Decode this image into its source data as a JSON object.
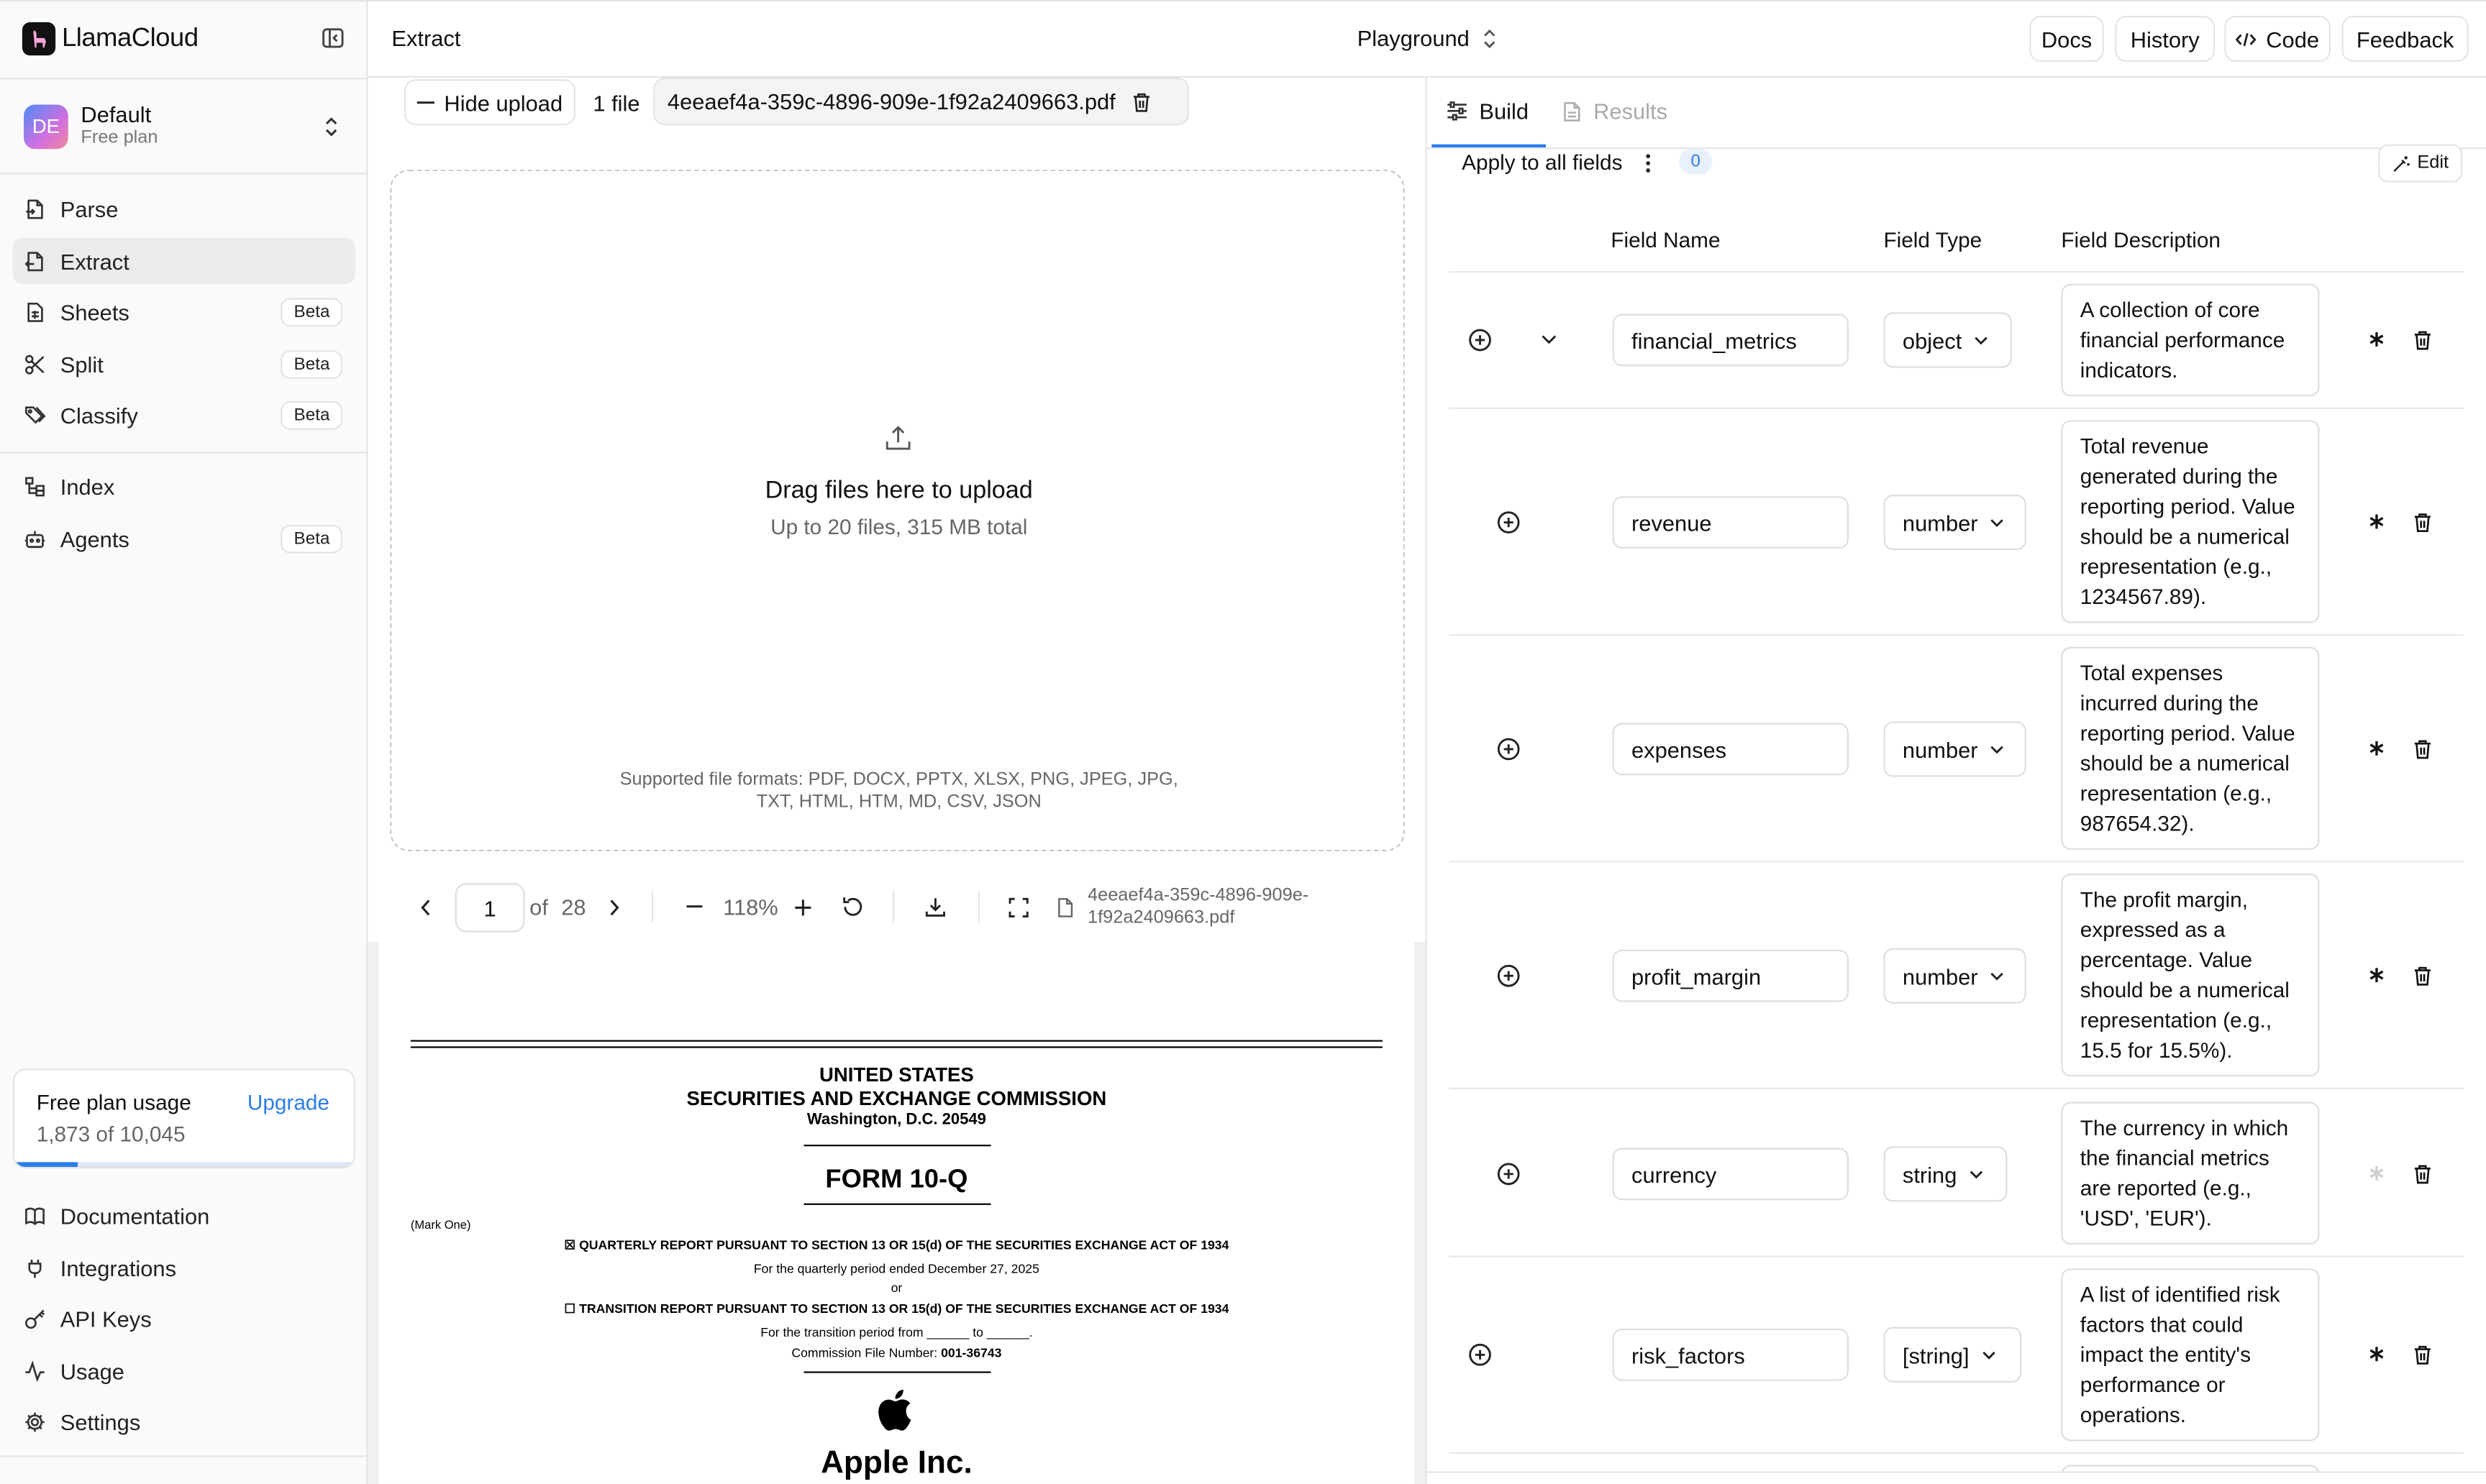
{
  "app": {
    "name": "LlamaCloud"
  },
  "workspace": {
    "initials": "DE",
    "name": "Default",
    "plan": "Free plan"
  },
  "nav": {
    "items": [
      {
        "label": "Parse",
        "icon": "document-arrow-icon",
        "badge": ""
      },
      {
        "label": "Extract",
        "icon": "document-arrow-icon",
        "badge": ""
      },
      {
        "label": "Sheets",
        "icon": "sheet-icon",
        "badge": "Beta"
      },
      {
        "label": "Split",
        "icon": "scissors-icon",
        "badge": "Beta"
      },
      {
        "label": "Classify",
        "icon": "tags-icon",
        "badge": "Beta"
      },
      {
        "label": "Index",
        "icon": "index-tree-icon",
        "badge": ""
      },
      {
        "label": "Agents",
        "icon": "robot-icon",
        "badge": "Beta"
      }
    ],
    "bottom": [
      {
        "label": "Documentation",
        "icon": "book-icon"
      },
      {
        "label": "Integrations",
        "icon": "plug-icon"
      },
      {
        "label": "API Keys",
        "icon": "key-icon"
      },
      {
        "label": "Usage",
        "icon": "activity-icon"
      },
      {
        "label": "Settings",
        "icon": "gear-icon"
      }
    ]
  },
  "usage": {
    "title": "Free plan usage",
    "upgrade": "Upgrade",
    "count": "1,873 of 10,045",
    "used": 1873,
    "total": 10045,
    "accent": "#2b7de9"
  },
  "header": {
    "page": "Extract",
    "mode": "Playground",
    "buttons": {
      "docs": "Docs",
      "history": "History",
      "code": "Code",
      "feedback": "Feedback"
    }
  },
  "upload": {
    "hide_label": "Hide upload",
    "file_count": "1 file",
    "file_name": "4eeaef4a-359c-4896-909e-1f92a2409663.pdf",
    "drop_title": "Drag files here to upload",
    "drop_subtitle": "Up to 20 files, 315 MB total",
    "formats_line1": "Supported file formats: PDF, DOCX, PPTX, XLSX, PNG, JPEG, JPG,",
    "formats_line2": "TXT, HTML, HTM, MD, CSV, JSON"
  },
  "viewer": {
    "page": "1",
    "of_label": "of",
    "total_pages": "28",
    "zoom": "118%",
    "file_line1": "4eeaef4a-359c-4896-909e-",
    "file_line2": "1f92a2409663.pdf"
  },
  "document": {
    "line1": "UNITED STATES",
    "line2": "SECURITIES AND EXCHANGE COMMISSION",
    "line3": "Washington, D.C. 20549",
    "form": "FORM 10-Q",
    "mark_one": "(Mark One)",
    "quarterly": "☒ QUARTERLY REPORT PURSUANT TO SECTION 13 OR 15(d) OF THE SECURITIES EXCHANGE ACT OF 1934",
    "period": "For the quarterly period ended December 27, 2025",
    "or": "or",
    "transition": "☐ TRANSITION REPORT PURSUANT TO SECTION 13 OR 15(d) OF THE SECURITIES EXCHANGE ACT OF 1934",
    "transition_period": "For the transition period from ______ to ______.",
    "commission_label": "Commission File Number: ",
    "commission_number": "001-36743",
    "company": "Apple Inc."
  },
  "panel": {
    "tabs": {
      "build": "Build",
      "results": "Results"
    },
    "apply_all": "Apply to all fields",
    "count": "0",
    "edit": "Edit",
    "columns": {
      "name": "Field Name",
      "type": "Field Type",
      "description": "Field Description"
    }
  },
  "fields": [
    {
      "name": "financial_metrics",
      "type": "object",
      "description": "A collection of core financial performance indicators.",
      "required": true
    },
    {
      "name": "revenue",
      "type": "number",
      "description": "Total revenue generated during the reporting period. Value should be a numerical representation (e.g., 1234567.89).",
      "required": true
    },
    {
      "name": "expenses",
      "type": "number",
      "description": "Total expenses incurred during the reporting period. Value should be a numerical representation (e.g., 987654.32).",
      "required": true
    },
    {
      "name": "profit_margin",
      "type": "number",
      "description": "The profit margin, expressed as a percentage. Value should be a numerical representation (e.g., 15.5 for 15.5%).",
      "required": true
    },
    {
      "name": "currency",
      "type": "string",
      "description": "The currency in which the financial metrics are reported (e.g., 'USD', 'EUR').",
      "required": false
    },
    {
      "name": "risk_factors",
      "type": "[string]",
      "description": "A list of identified risk factors that could impact the entity's performance or operations.",
      "required": true
    }
  ]
}
